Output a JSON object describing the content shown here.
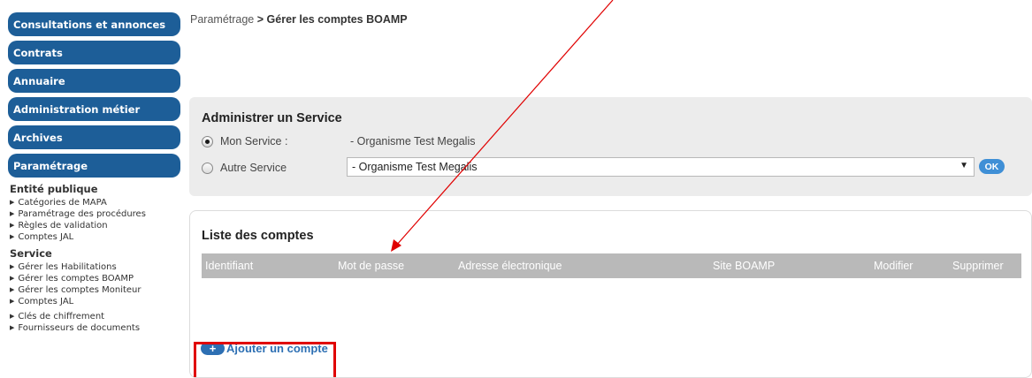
{
  "sidebar": {
    "nav": [
      {
        "label": "Consultations et annonces"
      },
      {
        "label": "Contrats"
      },
      {
        "label": "Annuaire"
      },
      {
        "label": "Administration métier"
      },
      {
        "label": "Archives"
      },
      {
        "label": "Paramétrage"
      }
    ],
    "entite_header": "Entité publique",
    "entite_items": [
      {
        "label": "Catégories de MAPA"
      },
      {
        "label": "Paramétrage des procédures"
      },
      {
        "label": "Règles de validation"
      },
      {
        "label": "Comptes JAL"
      }
    ],
    "service_header": "Service",
    "service_items": [
      {
        "label": "Gérer les Habilitations"
      },
      {
        "label": "Gérer les comptes BOAMP"
      },
      {
        "label": "Gérer les comptes Moniteur"
      },
      {
        "label": "Comptes JAL"
      }
    ],
    "other_items": [
      {
        "label": "Clés de chiffrement"
      },
      {
        "label": "Fournisseurs de documents"
      }
    ]
  },
  "breadcrumb": {
    "parent": "Paramétrage",
    "separator": ">",
    "current": "Gérer les comptes BOAMP"
  },
  "admin_panel": {
    "title": "Administrer un Service",
    "mon_service_label": "Mon Service :",
    "mon_service_value": "- Organisme Test Megalis",
    "autre_service_label": "Autre Service",
    "select_value": "- Organisme Test Megalis",
    "ok_label": "OK"
  },
  "list_panel": {
    "title": "Liste des comptes",
    "columns": [
      "Identifiant",
      "Mot de passe",
      "Adresse électronique",
      "Site BOAMP",
      "Modifier",
      "Supprimer"
    ],
    "rows": [],
    "add_label": "Ajouter un compte"
  },
  "colors": {
    "nav_blue": "#1d5e98",
    "link_blue": "#2d6fb3",
    "annotation_red": "#e00000"
  }
}
